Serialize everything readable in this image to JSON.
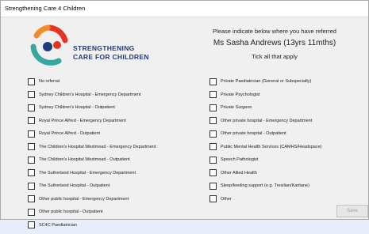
{
  "window": {
    "title": "Strengthening Care 4 Children"
  },
  "logo": {
    "line1": "STRENGTHENING",
    "line2": "CARE FOR CHILDREN"
  },
  "header": {
    "instruction": "Please indicate below where you have referred",
    "patient": "Ms Sasha Andrews (13yrs 11mths)",
    "tick_all": "Tick all that apply"
  },
  "left_options": [
    {
      "label": "No referral"
    },
    {
      "label": "Sydney Children's Hospital - Emergency Department"
    },
    {
      "label": "Sydney Children's Hospital - Outpatient"
    },
    {
      "label": "Royal Prince Alfred - Emergency Department"
    },
    {
      "label": "Royal Prince Alfred - Outpatient"
    },
    {
      "label": "The Children's Hospital Westmead - Emergency Department"
    },
    {
      "label": "The Children's Hospital Westmead - Outpatient"
    },
    {
      "label": "The Sutherland Hospital - Emergency Department"
    },
    {
      "label": "The Sutherland Hospital - Outpatient"
    },
    {
      "label": "Other public hospital - Emergency Department"
    },
    {
      "label": "Other public hospital - Outpatient"
    },
    {
      "label": "SC4C Paediatrician"
    }
  ],
  "right_options": [
    {
      "label": "Private Paediatrician (General or Subspecialty)"
    },
    {
      "label": "Private Psychologist"
    },
    {
      "label": "Private Surgeon"
    },
    {
      "label": "Other private hospital - Emergency Department"
    },
    {
      "label": "Other private hospital - Outpatient"
    },
    {
      "label": "Public Mental Health Services (CAMHS/Headspace)"
    },
    {
      "label": "Speech Pathologist"
    },
    {
      "label": "Other Allied Health"
    },
    {
      "label": "Sleep/feeding support (e.g. Tresilian/Karitane)"
    },
    {
      "label": "Other"
    }
  ],
  "footer": {
    "save_label": "Save"
  }
}
